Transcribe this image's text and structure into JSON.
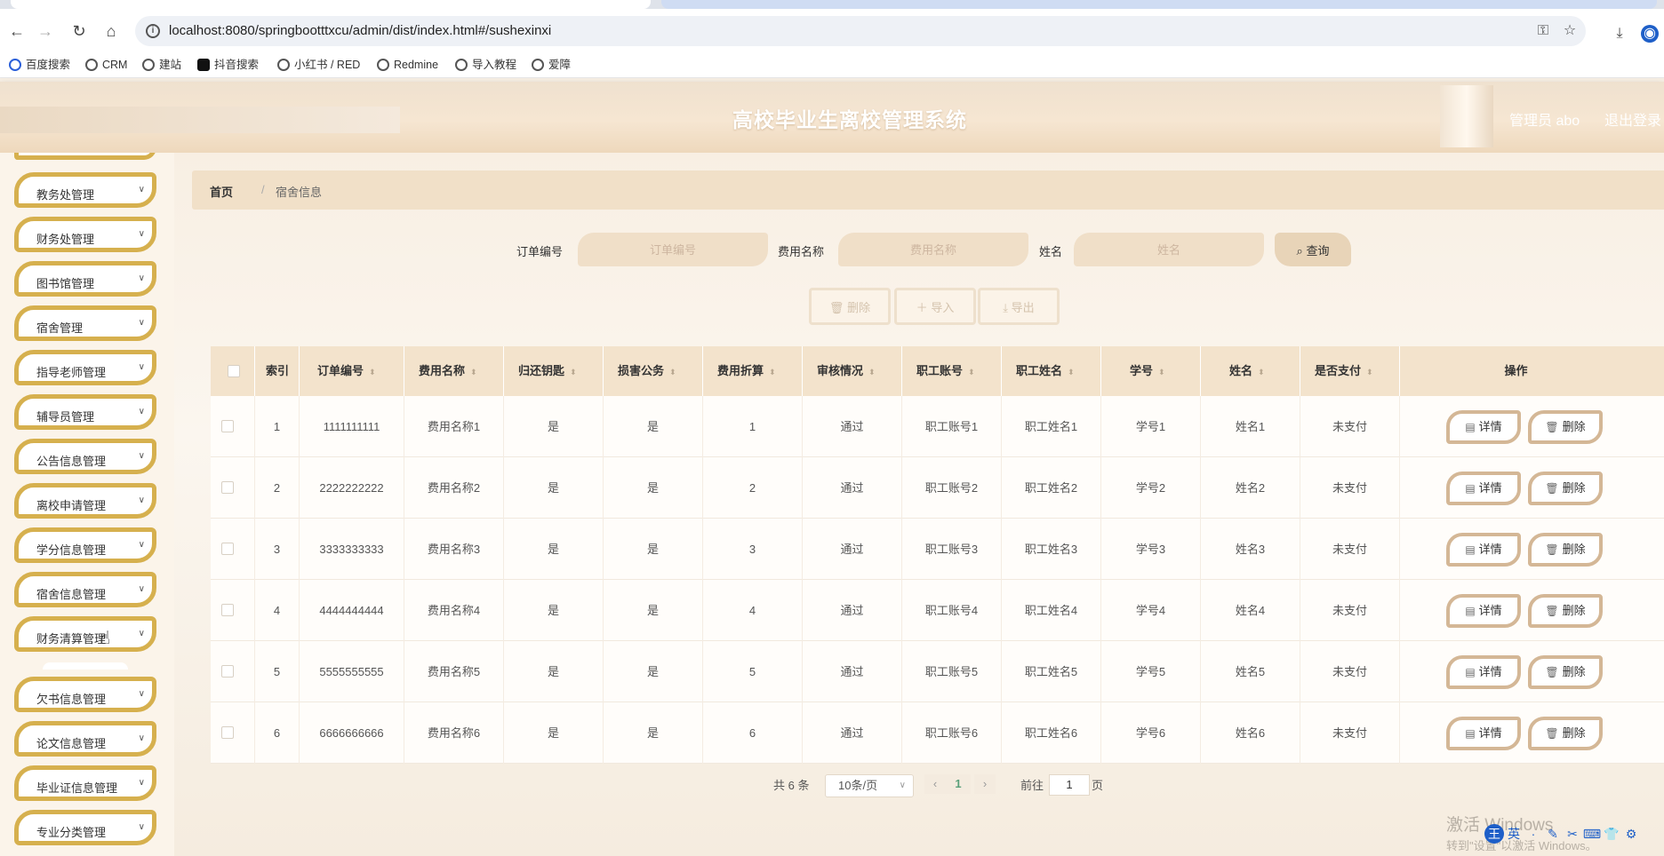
{
  "browser": {
    "url": "localhost:8080/springbootttxcu/admin/dist/index.html#/sushexinxi",
    "bookmarks": [
      "百度搜索",
      "CRM",
      "建站",
      "抖音搜索",
      "小红书 / RED",
      "Redmine",
      "导入教程",
      "爱障"
    ]
  },
  "header": {
    "title": "高校毕业生离校管理系统",
    "admin": "管理员 abo",
    "logout": "退出登录"
  },
  "sidebar": {
    "items": [
      {
        "label": "教务处管理"
      },
      {
        "label": "财务处管理"
      },
      {
        "label": "图书馆管理"
      },
      {
        "label": "宿舍管理"
      },
      {
        "label": "指导老师管理"
      },
      {
        "label": "辅导员管理"
      },
      {
        "label": "公告信息管理"
      },
      {
        "label": "离校申请管理"
      },
      {
        "label": "学分信息管理"
      },
      {
        "label": "宿舍信息管理"
      },
      {
        "label": "财务清算管理"
      },
      {
        "label": "欠书信息管理"
      },
      {
        "label": "论文信息管理"
      },
      {
        "label": "毕业证信息管理"
      },
      {
        "label": "专业分类管理"
      }
    ]
  },
  "breadcrumb": {
    "home": "首页",
    "separator": "/",
    "current": "宿舍信息"
  },
  "search": {
    "fields": [
      {
        "label": "订单编号",
        "placeholder": "订单编号"
      },
      {
        "label": "费用名称",
        "placeholder": "费用名称"
      },
      {
        "label": "姓名",
        "placeholder": "姓名"
      }
    ],
    "button": "查询"
  },
  "actions": {
    "delete": "删除",
    "import": "导入",
    "export": "导出"
  },
  "table": {
    "columns": [
      "索引",
      "订单编号",
      "费用名称",
      "归还钥匙",
      "损害公务",
      "费用折算",
      "审核情况",
      "职工账号",
      "职工姓名",
      "学号",
      "姓名",
      "是否支付",
      "操作"
    ],
    "rows": [
      [
        "1",
        "1111111111",
        "费用名称1",
        "是",
        "是",
        "1",
        "通过",
        "职工账号1",
        "职工姓名1",
        "学号1",
        "姓名1",
        "未支付"
      ],
      [
        "2",
        "2222222222",
        "费用名称2",
        "是",
        "是",
        "2",
        "通过",
        "职工账号2",
        "职工姓名2",
        "学号2",
        "姓名2",
        "未支付"
      ],
      [
        "3",
        "3333333333",
        "费用名称3",
        "是",
        "是",
        "3",
        "通过",
        "职工账号3",
        "职工姓名3",
        "学号3",
        "姓名3",
        "未支付"
      ],
      [
        "4",
        "4444444444",
        "费用名称4",
        "是",
        "是",
        "4",
        "通过",
        "职工账号4",
        "职工姓名4",
        "学号4",
        "姓名4",
        "未支付"
      ],
      [
        "5",
        "5555555555",
        "费用名称5",
        "是",
        "是",
        "5",
        "通过",
        "职工账号5",
        "职工姓名5",
        "学号5",
        "姓名5",
        "未支付"
      ],
      [
        "6",
        "6666666666",
        "费用名称6",
        "是",
        "是",
        "6",
        "通过",
        "职工账号6",
        "职工姓名6",
        "学号6",
        "姓名6",
        "未支付"
      ]
    ],
    "row_actions": {
      "detail": "详情",
      "delete": "删除"
    }
  },
  "pagination": {
    "total": "共 6 条",
    "page_size": "10条/页",
    "current_page": "1",
    "goto_label": "前往",
    "goto_value": "1",
    "page_suffix": "页"
  },
  "watermark": {
    "line1": "激活 Windows",
    "line2": "转到\"设置\"以激活 Windows。"
  },
  "ime": {
    "mode": "英"
  },
  "colors": {
    "menu_border": "#d6b04e",
    "header_bg": "#f3e3cc",
    "accent_green": "#5aa07a"
  }
}
